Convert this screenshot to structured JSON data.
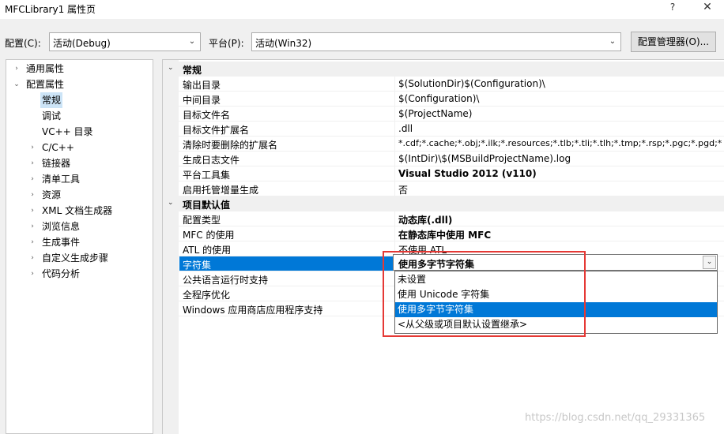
{
  "window": {
    "title": "MFCLibrary1 属性页",
    "help_label": "?",
    "close_label": "✕"
  },
  "toolbar": {
    "config_label": "配置(C):",
    "config_value": "活动(Debug)",
    "platform_label": "平台(P):",
    "platform_value": "活动(Win32)",
    "config_manager_label": "配置管理器(O)..."
  },
  "tree": {
    "items": [
      {
        "label": "通用属性",
        "expander": "›"
      },
      {
        "label": "配置属性",
        "expander": "⌄"
      },
      {
        "label": "常规",
        "expander": ""
      },
      {
        "label": "调试",
        "expander": ""
      },
      {
        "label": "VC++ 目录",
        "expander": ""
      },
      {
        "label": "C/C++",
        "expander": "›"
      },
      {
        "label": "链接器",
        "expander": "›"
      },
      {
        "label": "清单工具",
        "expander": "›"
      },
      {
        "label": "资源",
        "expander": "›"
      },
      {
        "label": "XML 文档生成器",
        "expander": "›"
      },
      {
        "label": "浏览信息",
        "expander": "›"
      },
      {
        "label": "生成事件",
        "expander": "›"
      },
      {
        "label": "自定义生成步骤",
        "expander": "›"
      },
      {
        "label": "代码分析",
        "expander": "›"
      }
    ]
  },
  "grid": {
    "section1": {
      "title": "常规",
      "expander": "⌄"
    },
    "rows1": [
      {
        "name": "输出目录",
        "value": "$(SolutionDir)$(Configuration)\\"
      },
      {
        "name": "中间目录",
        "value": "$(Configuration)\\"
      },
      {
        "name": "目标文件名",
        "value": "$(ProjectName)"
      },
      {
        "name": "目标文件扩展名",
        "value": ".dll"
      },
      {
        "name": "清除时要删除的扩展名",
        "value": "*.cdf;*.cache;*.obj;*.ilk;*.resources;*.tlb;*.tli;*.tlh;*.tmp;*.rsp;*.pgc;*.pgd;*"
      },
      {
        "name": "生成日志文件",
        "value": "$(IntDir)\\$(MSBuildProjectName).log"
      },
      {
        "name": "平台工具集",
        "value": "Visual Studio 2012 (v110)"
      },
      {
        "name": "启用托管增量生成",
        "value": "否"
      }
    ],
    "section2": {
      "title": "项目默认值",
      "expander": "⌄"
    },
    "rows2": [
      {
        "name": "配置类型",
        "value": "动态库(.dll)"
      },
      {
        "name": "MFC 的使用",
        "value": "在静态库中使用 MFC"
      },
      {
        "name": "ATL 的使用",
        "value": "不使用 ATL"
      },
      {
        "name": "字符集",
        "value": "使用多字节字符集"
      },
      {
        "name": "公共语言运行时支持",
        "value": ""
      },
      {
        "name": "全程序优化",
        "value": ""
      },
      {
        "name": "Windows 应用商店应用程序支持",
        "value": ""
      }
    ]
  },
  "dropdown": {
    "selected": "使用多字节字符集",
    "arrow": "⌄",
    "options": [
      "未设置",
      "使用 Unicode 字符集",
      "使用多字节字符集",
      "<从父级或项目默认设置继承>"
    ]
  },
  "watermark": "https://blog.csdn.net/qq_29331365"
}
